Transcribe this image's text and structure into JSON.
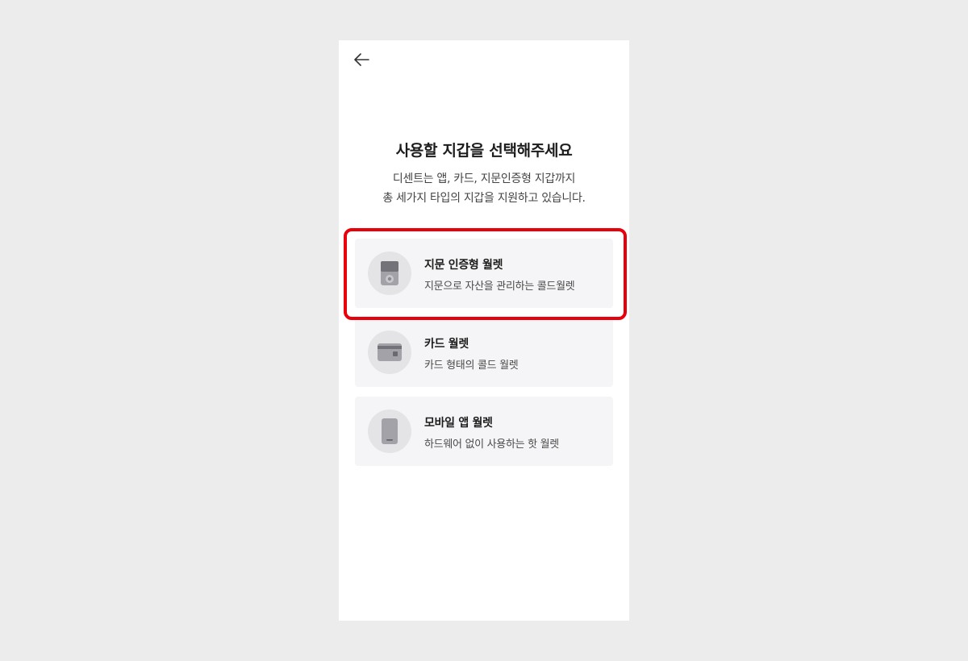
{
  "header": {
    "back_icon": "arrow-left-icon"
  },
  "title": "사용할 지갑을 선택해주세요",
  "subtitle": {
    "line1": "디센트는 앱, 카드, 지문인증형 지갑까지",
    "line2": "총 세가지 타입의 지갑을 지원하고 있습니다."
  },
  "wallets": [
    {
      "icon": "fingerprint-device-icon",
      "title": "지문 인증형 월렛",
      "description": "지문으로 자산을 관리하는 콜드월렛",
      "highlighted": true
    },
    {
      "icon": "card-icon",
      "title": "카드 월렛",
      "description": "카드 형태의 콜드 월렛",
      "highlighted": false
    },
    {
      "icon": "mobile-phone-icon",
      "title": "모바일 앱 월렛",
      "description": "하드웨어 없이 사용하는 핫 월렛",
      "highlighted": false
    }
  ],
  "colors": {
    "background": "#ececec",
    "screen": "#ffffff",
    "card": "#f5f5f7",
    "icon_circle": "#e4e4e6",
    "icon_fill": "#9a9aa0",
    "highlight": "#e8000b"
  }
}
